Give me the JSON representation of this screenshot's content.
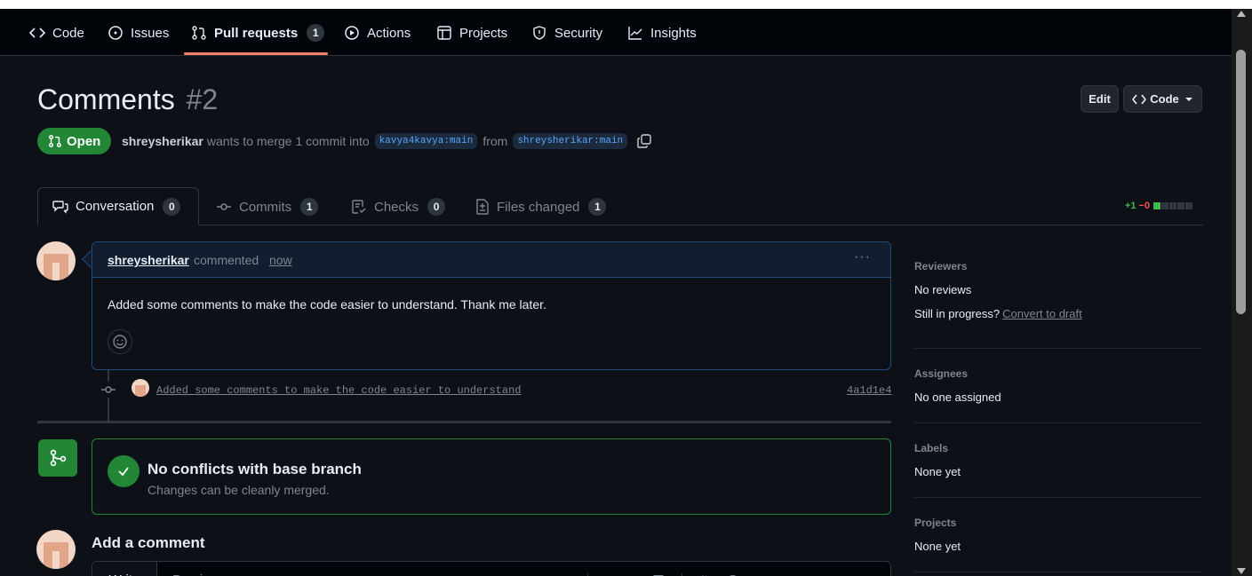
{
  "nav": {
    "code": "Code",
    "issues": "Issues",
    "pull_requests": "Pull requests",
    "pull_requests_count": "1",
    "actions": "Actions",
    "projects": "Projects",
    "security": "Security",
    "insights": "Insights"
  },
  "pr": {
    "title": "Comments",
    "number": "#2",
    "state": "Open",
    "author": "shreysherikar",
    "merge_text": "wants to merge 1 commit into",
    "base_branch": "kavya4kavya:main",
    "from_text": "from",
    "head_branch": "shreysherikar:main",
    "edit_label": "Edit",
    "code_label": "Code"
  },
  "tabs": {
    "conversation": "Conversation",
    "conversation_count": "0",
    "commits": "Commits",
    "commits_count": "1",
    "checks": "Checks",
    "checks_count": "0",
    "files_changed": "Files changed",
    "files_changed_count": "1"
  },
  "diffstat": {
    "additions": "+1",
    "deletions": "−0",
    "add_color": "#3fb950",
    "neutral_color": "#30363d"
  },
  "comment": {
    "author": "shreysherikar",
    "action": "commented",
    "time": "now",
    "menu": "···",
    "body": "Added some comments to make the code easier to understand. Thank me later."
  },
  "commit": {
    "message": "Added some comments to make the code easier to understand",
    "sha": "4a1d1e4"
  },
  "mergebox": {
    "title": "No conflicts with base branch",
    "subtitle": "Changes can be cleanly merged."
  },
  "add_comment": {
    "title": "Add a comment",
    "write_tab": "Write",
    "preview_tab": "Preview",
    "toolbar": [
      "H",
      "B",
      "I"
    ]
  },
  "sidebar": {
    "reviewers": {
      "heading": "Reviewers",
      "value": "No reviews",
      "progress_text": "Still in progress?",
      "draft_link": "Convert to draft"
    },
    "assignees": {
      "heading": "Assignees",
      "value": "No one assigned"
    },
    "labels": {
      "heading": "Labels",
      "value": "None yet"
    },
    "projects": {
      "heading": "Projects",
      "value": "None yet"
    }
  },
  "colors": {
    "background": "#0d1117",
    "accent_green": "#238636",
    "link_blue": "#58a6ff",
    "nav_underline": "#f78166"
  }
}
